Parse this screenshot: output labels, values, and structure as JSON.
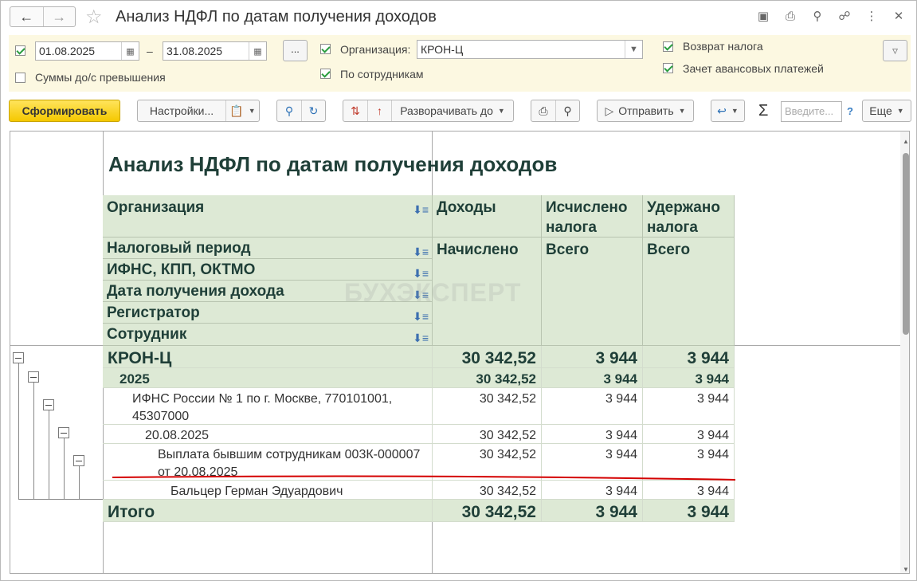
{
  "window": {
    "title": "Анализ НДФЛ по датам получения доходов"
  },
  "filters": {
    "date_from": "01.08.2025",
    "date_sep": "–",
    "date_to": "31.08.2025",
    "dots_label": "...",
    "sums_label": "Суммы до/с превышения",
    "org_label": "Организация:",
    "org_value": "КРОН-Ц",
    "by_employees_label": "По сотрудникам",
    "tax_refund_label": "Возврат налога",
    "advance_offset_label": "Зачет авансовых платежей"
  },
  "toolbar": {
    "generate": "Сформировать",
    "settings": "Настройки...",
    "expand_to": "Разворачивать до",
    "send": "Отправить",
    "search_placeholder": "Введите...",
    "help": "?",
    "more": "Еще",
    "sigma": "Σ"
  },
  "report": {
    "title": "Анализ НДФЛ по датам получения доходов",
    "watermark": "БУХЭКСПЕРТ",
    "headers": {
      "org": "Организация",
      "period": "Налоговый период",
      "ifns": "ИФНС, КПП, ОКТМО",
      "date": "Дата получения дохода",
      "registrar": "Регистратор",
      "employee": "Сотрудник",
      "income": "Доходы",
      "income_sub": "Начислено",
      "calc": "Исчислено налога",
      "calc_sub": "Всего",
      "withheld": "Удержано налога",
      "withheld_sub": "Всего"
    },
    "rows": [
      {
        "label": "КРОН-Ц",
        "income": "30 342,52",
        "calc": "3 944",
        "withheld": "3 944"
      },
      {
        "label": "2025",
        "income": "30 342,52",
        "calc": "3 944",
        "withheld": "3 944"
      },
      {
        "label": "ИФНС России № 1 по г. Москве, 770101001, 45307000",
        "income": "30 342,52",
        "calc": "3 944",
        "withheld": "3 944"
      },
      {
        "label": "20.08.2025",
        "income": "30 342,52",
        "calc": "3 944",
        "withheld": "3 944"
      },
      {
        "label": "Выплата бывшим сотрудникам 003К-000007 от 20.08.2025",
        "income": "30 342,52",
        "calc": "3 944",
        "withheld": "3 944"
      },
      {
        "label": "Бальцер Герман Эдуардович",
        "income": "30 342,52",
        "calc": "3 944",
        "withheld": "3 944"
      }
    ],
    "total": {
      "label": "Итого",
      "income": "30 342,52",
      "calc": "3 944",
      "withheld": "3 944"
    }
  },
  "colors": {
    "header_bg": "#dde9d5",
    "header_text": "#1f3f38",
    "filter_bg": "#fcf8e1",
    "primary_button": "#f5c800",
    "annotation_line": "#d40000"
  }
}
